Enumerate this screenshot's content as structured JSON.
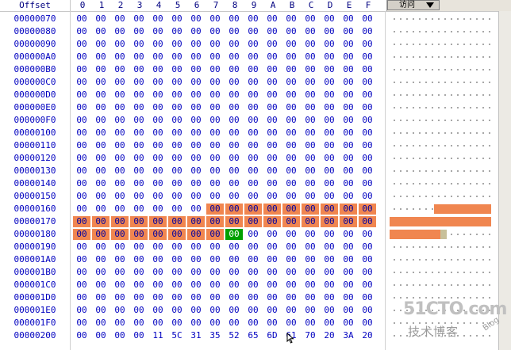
{
  "header": {
    "offset_label": "Offset",
    "columns": [
      "0",
      "1",
      "2",
      "3",
      "4",
      "5",
      "6",
      "7",
      "8",
      "9",
      "A",
      "B",
      "C",
      "D",
      "E",
      "F"
    ],
    "column_mode_label": "访问"
  },
  "rows": [
    {
      "offset": "00000070",
      "bytes": [
        "00",
        "00",
        "00",
        "00",
        "00",
        "00",
        "00",
        "00",
        "00",
        "00",
        "00",
        "00",
        "00",
        "00",
        "00",
        "00"
      ],
      "selected": [],
      "cursor": []
    },
    {
      "offset": "00000080",
      "bytes": [
        "00",
        "00",
        "00",
        "00",
        "00",
        "00",
        "00",
        "00",
        "00",
        "00",
        "00",
        "00",
        "00",
        "00",
        "00",
        "00"
      ],
      "selected": [],
      "cursor": []
    },
    {
      "offset": "00000090",
      "bytes": [
        "00",
        "00",
        "00",
        "00",
        "00",
        "00",
        "00",
        "00",
        "00",
        "00",
        "00",
        "00",
        "00",
        "00",
        "00",
        "00"
      ],
      "selected": [],
      "cursor": []
    },
    {
      "offset": "000000A0",
      "bytes": [
        "00",
        "00",
        "00",
        "00",
        "00",
        "00",
        "00",
        "00",
        "00",
        "00",
        "00",
        "00",
        "00",
        "00",
        "00",
        "00"
      ],
      "selected": [],
      "cursor": []
    },
    {
      "offset": "000000B0",
      "bytes": [
        "00",
        "00",
        "00",
        "00",
        "00",
        "00",
        "00",
        "00",
        "00",
        "00",
        "00",
        "00",
        "00",
        "00",
        "00",
        "00"
      ],
      "selected": [],
      "cursor": []
    },
    {
      "offset": "000000C0",
      "bytes": [
        "00",
        "00",
        "00",
        "00",
        "00",
        "00",
        "00",
        "00",
        "00",
        "00",
        "00",
        "00",
        "00",
        "00",
        "00",
        "00"
      ],
      "selected": [],
      "cursor": []
    },
    {
      "offset": "000000D0",
      "bytes": [
        "00",
        "00",
        "00",
        "00",
        "00",
        "00",
        "00",
        "00",
        "00",
        "00",
        "00",
        "00",
        "00",
        "00",
        "00",
        "00"
      ],
      "selected": [],
      "cursor": []
    },
    {
      "offset": "000000E0",
      "bytes": [
        "00",
        "00",
        "00",
        "00",
        "00",
        "00",
        "00",
        "00",
        "00",
        "00",
        "00",
        "00",
        "00",
        "00",
        "00",
        "00"
      ],
      "selected": [],
      "cursor": []
    },
    {
      "offset": "000000F0",
      "bytes": [
        "00",
        "00",
        "00",
        "00",
        "00",
        "00",
        "00",
        "00",
        "00",
        "00",
        "00",
        "00",
        "00",
        "00",
        "00",
        "00"
      ],
      "selected": [],
      "cursor": []
    },
    {
      "offset": "00000100",
      "bytes": [
        "00",
        "00",
        "00",
        "00",
        "00",
        "00",
        "00",
        "00",
        "00",
        "00",
        "00",
        "00",
        "00",
        "00",
        "00",
        "00"
      ],
      "selected": [],
      "cursor": []
    },
    {
      "offset": "00000110",
      "bytes": [
        "00",
        "00",
        "00",
        "00",
        "00",
        "00",
        "00",
        "00",
        "00",
        "00",
        "00",
        "00",
        "00",
        "00",
        "00",
        "00"
      ],
      "selected": [],
      "cursor": []
    },
    {
      "offset": "00000120",
      "bytes": [
        "00",
        "00",
        "00",
        "00",
        "00",
        "00",
        "00",
        "00",
        "00",
        "00",
        "00",
        "00",
        "00",
        "00",
        "00",
        "00"
      ],
      "selected": [],
      "cursor": []
    },
    {
      "offset": "00000130",
      "bytes": [
        "00",
        "00",
        "00",
        "00",
        "00",
        "00",
        "00",
        "00",
        "00",
        "00",
        "00",
        "00",
        "00",
        "00",
        "00",
        "00"
      ],
      "selected": [],
      "cursor": []
    },
    {
      "offset": "00000140",
      "bytes": [
        "00",
        "00",
        "00",
        "00",
        "00",
        "00",
        "00",
        "00",
        "00",
        "00",
        "00",
        "00",
        "00",
        "00",
        "00",
        "00"
      ],
      "selected": [],
      "cursor": []
    },
    {
      "offset": "00000150",
      "bytes": [
        "00",
        "00",
        "00",
        "00",
        "00",
        "00",
        "00",
        "00",
        "00",
        "00",
        "00",
        "00",
        "00",
        "00",
        "00",
        "00"
      ],
      "selected": [],
      "cursor": []
    },
    {
      "offset": "00000160",
      "bytes": [
        "00",
        "00",
        "00",
        "00",
        "00",
        "00",
        "00",
        "00",
        "00",
        "00",
        "00",
        "00",
        "00",
        "00",
        "00",
        "00"
      ],
      "selected": [
        7,
        8,
        9,
        10,
        11,
        12,
        13,
        14,
        15
      ],
      "cursor": []
    },
    {
      "offset": "00000170",
      "bytes": [
        "00",
        "00",
        "00",
        "00",
        "00",
        "00",
        "00",
        "00",
        "00",
        "00",
        "00",
        "00",
        "00",
        "00",
        "00",
        "00"
      ],
      "selected": [
        0,
        1,
        2,
        3,
        4,
        5,
        6,
        7,
        8,
        9,
        10,
        11,
        12,
        13,
        14,
        15
      ],
      "cursor": []
    },
    {
      "offset": "00000180",
      "bytes": [
        "00",
        "00",
        "00",
        "00",
        "00",
        "00",
        "00",
        "00",
        "00",
        "00",
        "00",
        "00",
        "00",
        "00",
        "00",
        "00"
      ],
      "selected": [
        0,
        1,
        2,
        3,
        4,
        5,
        6,
        7
      ],
      "cursor": [
        8
      ]
    },
    {
      "offset": "00000190",
      "bytes": [
        "00",
        "00",
        "00",
        "00",
        "00",
        "00",
        "00",
        "00",
        "00",
        "00",
        "00",
        "00",
        "00",
        "00",
        "00",
        "00"
      ],
      "selected": [],
      "cursor": []
    },
    {
      "offset": "000001A0",
      "bytes": [
        "00",
        "00",
        "00",
        "00",
        "00",
        "00",
        "00",
        "00",
        "00",
        "00",
        "00",
        "00",
        "00",
        "00",
        "00",
        "00"
      ],
      "selected": [],
      "cursor": []
    },
    {
      "offset": "000001B0",
      "bytes": [
        "00",
        "00",
        "00",
        "00",
        "00",
        "00",
        "00",
        "00",
        "00",
        "00",
        "00",
        "00",
        "00",
        "00",
        "00",
        "00"
      ],
      "selected": [],
      "cursor": []
    },
    {
      "offset": "000001C0",
      "bytes": [
        "00",
        "00",
        "00",
        "00",
        "00",
        "00",
        "00",
        "00",
        "00",
        "00",
        "00",
        "00",
        "00",
        "00",
        "00",
        "00"
      ],
      "selected": [],
      "cursor": []
    },
    {
      "offset": "000001D0",
      "bytes": [
        "00",
        "00",
        "00",
        "00",
        "00",
        "00",
        "00",
        "00",
        "00",
        "00",
        "00",
        "00",
        "00",
        "00",
        "00",
        "00"
      ],
      "selected": [],
      "cursor": []
    },
    {
      "offset": "000001E0",
      "bytes": [
        "00",
        "00",
        "00",
        "00",
        "00",
        "00",
        "00",
        "00",
        "00",
        "00",
        "00",
        "00",
        "00",
        "00",
        "00",
        "00"
      ],
      "selected": [],
      "cursor": []
    },
    {
      "offset": "000001F0",
      "bytes": [
        "00",
        "00",
        "00",
        "00",
        "00",
        "00",
        "00",
        "00",
        "00",
        "00",
        "00",
        "00",
        "00",
        "00",
        "00",
        "00"
      ],
      "selected": [],
      "cursor": []
    },
    {
      "offset": "00000200",
      "bytes": [
        "00",
        "00",
        "00",
        "00",
        "11",
        "5C",
        "31",
        "35",
        "52",
        "65",
        "6D",
        "61",
        "70",
        "20",
        "3A",
        "20"
      ],
      "selected": [],
      "cursor": []
    }
  ],
  "watermark": {
    "main": "51CTO.com",
    "sub": "技术博客",
    "blog": "Blog"
  },
  "icons": {
    "dropdown": "triangle-down-icon",
    "pointer": "arrow-cursor-icon"
  },
  "colors": {
    "selection": "#f08650",
    "cursor": "#00a000",
    "hex_text": "#0000c0"
  }
}
